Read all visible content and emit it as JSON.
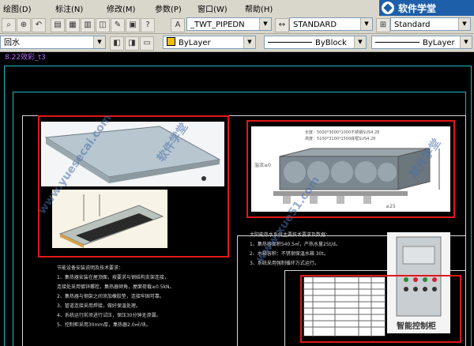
{
  "menus": [
    "绘图(D)",
    "标注(N)",
    "修改(M)",
    "参数(P)",
    "窗口(W)",
    "帮助(H)"
  ],
  "logo": {
    "text": "软件学堂"
  },
  "toolbar1": {
    "pipe_combo": "_TWT_PIPEDN",
    "text_style_combo": "STANDARD",
    "dim_style_combo": "Standard"
  },
  "toolbar2": {
    "layer_combo": "回水",
    "color_combo": "ByLayer",
    "linetype_combo": "ByBlock",
    "lineweight_combo": "ByLayer"
  },
  "drawing_tab": "8.22效彩_t3",
  "drawing": {
    "tank_dims": [
      "长度：5000*3000*1000不锈钢SUS4.28",
      "高度：5100*3100*1500底框SUS4.28"
    ],
    "tank_side_label": "溢流≥0",
    "tank_bottom_label": "≤25",
    "notes_left_title": "节能设备安装说明及技术要求：",
    "notes_left": [
      "1、集热器安装在屋顶面，按要求与钢结构支架连接，",
      "  连接处采用镀锌螺栓，集热器倾角，屋面荷载≥0.5kN。",
      "2、集热器与钢架之间须加橡胶垫，连接牢固可靠。",
      "3、管道连接采用焊接，做好保温处理。",
      "4、系统运行前须进行试压，保压30分钟无渗漏。",
      "5、控制柜采用30mm厚，集热器2.0㎡/块。"
    ],
    "notes_right_title": "太阳能热水系统主要技术要求及数据：",
    "notes_right": [
      "1、集热器面积540.5㎡，产热水量25t/d。",
      "2、水箱容积：不锈钢保温水箱 30t。",
      "3、系统采用强制循环方式运行。"
    ],
    "cabinet_title": "智能控制柜"
  },
  "colors": {
    "cad_background": "#000000",
    "frame_cyan": "#19b8c8",
    "highlight_red": "#e01818",
    "ui_gray": "#d9d6cc",
    "logo_blue": "#1d5fa8"
  }
}
